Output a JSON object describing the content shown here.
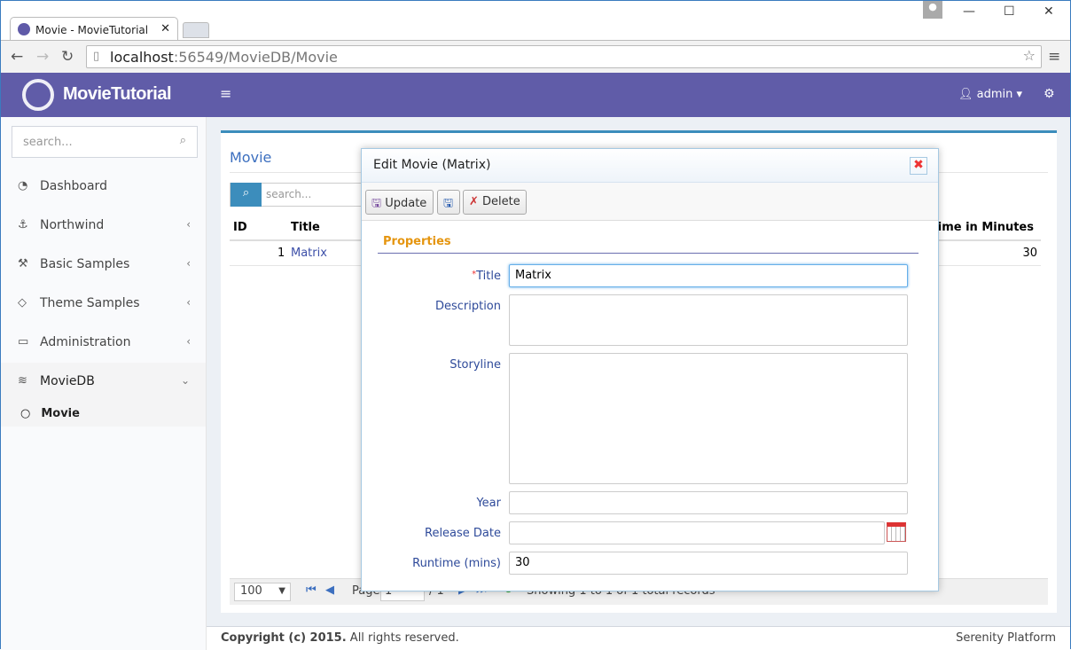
{
  "browser": {
    "tab_title": "Movie - MovieTutorial",
    "url_host": "localhost",
    "url_path": ":56549/MovieDB/Movie"
  },
  "app": {
    "brand": "MovieTutorial",
    "user": "admin",
    "accent": "#605ca8"
  },
  "sidebar": {
    "search_placeholder": "search...",
    "items": [
      {
        "label": "Dashboard",
        "icon": "dashboard-icon"
      },
      {
        "label": "Northwind",
        "icon": "anchor-icon"
      },
      {
        "label": "Basic Samples",
        "icon": "magic-icon"
      },
      {
        "label": "Theme Samples",
        "icon": "diamond-icon"
      },
      {
        "label": "Administration",
        "icon": "desktop-icon"
      },
      {
        "label": "MovieDB",
        "icon": "layers-icon"
      }
    ],
    "sub_item": "Movie"
  },
  "grid": {
    "title": "Movie",
    "search_placeholder": "search...",
    "columns": [
      "ID",
      "Title",
      "Runtime in Minutes"
    ],
    "rows": [
      {
        "id": "1",
        "title": "Matrix",
        "runtime": "30"
      }
    ],
    "pager": {
      "page_size": "100",
      "page_label": "Page",
      "page": "1",
      "of": "/ 1",
      "status": "Showing 1 to 1 of 1 total records"
    }
  },
  "dialog": {
    "title": "Edit Movie (Matrix)",
    "update": "Update",
    "delete": "Delete",
    "section": "Properties",
    "fields": {
      "title_label": "Title",
      "title_value": "Matrix",
      "description_label": "Description",
      "storyline_label": "Storyline",
      "year_label": "Year",
      "release_label": "Release Date",
      "runtime_label": "Runtime (mins)",
      "runtime_value": "30"
    }
  },
  "footer": {
    "copyright": "Copyright (c) 2015.",
    "rights": "All rights reserved.",
    "platform": "Serenity Platform"
  }
}
